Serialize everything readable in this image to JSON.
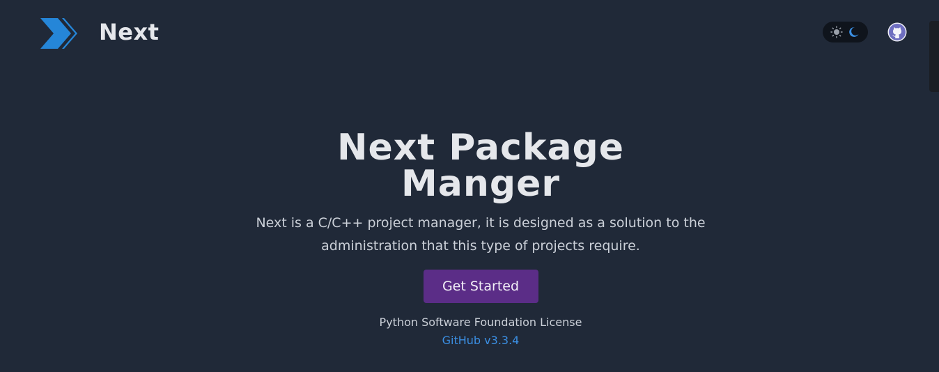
{
  "header": {
    "brand_name": "Next",
    "logo_icon": "next-chevron-logo",
    "theme_toggle": {
      "light_icon": "sun-icon",
      "dark_icon": "moon-icon",
      "active": "dark"
    },
    "github_icon": "github-icon"
  },
  "hero": {
    "title": "Next Package Manger",
    "description": "Next is a C/C++ project manager, it is designed as a solution to the administration that this type of projects require.",
    "cta_label": "Get Started",
    "license": "Python Software Foundation License",
    "release_link": "GitHub v3.3.4"
  },
  "colors": {
    "background": "#202938",
    "accent_button": "#5b2d87",
    "link": "#3b8fe3",
    "logo_blue": "#2586d8"
  }
}
